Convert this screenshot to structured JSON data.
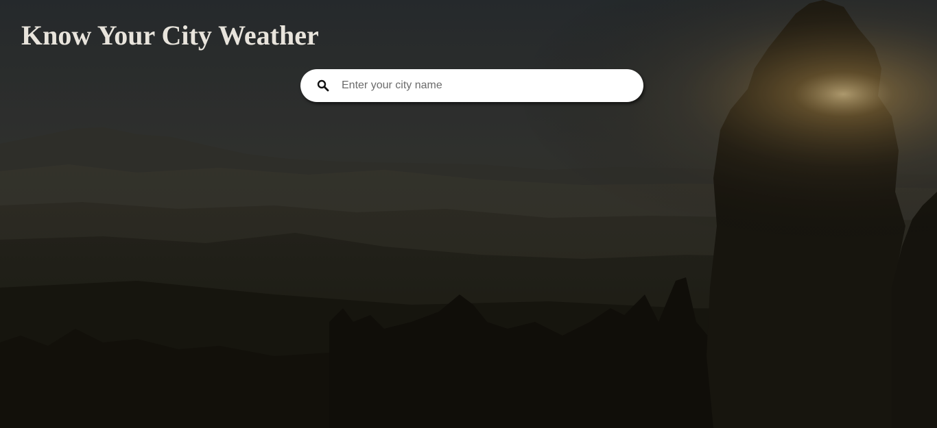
{
  "header": {
    "title": "Know Your City Weather"
  },
  "search": {
    "icon": "search-icon",
    "value": "",
    "placeholder": "Enter your city name"
  },
  "background": {
    "description_colors": {
      "sky_top": "#2f3437",
      "haze": "#4a4a40",
      "foreground": "#15130d",
      "sun_glow": "#d8b870"
    }
  }
}
